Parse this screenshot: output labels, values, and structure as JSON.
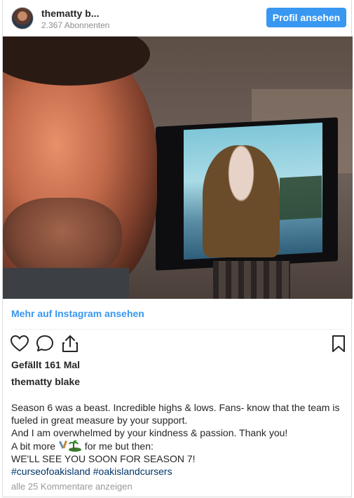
{
  "header": {
    "username": "thematty b...",
    "followers": "2.367 Abonnenten",
    "profile_button": "Profil ansehen"
  },
  "photo": {
    "alt_icon": "photo"
  },
  "more_link": "Mehr auf Instagram ansehen",
  "actions": {
    "like_icon": "heart-icon",
    "comment_icon": "comment-icon",
    "share_icon": "share-icon",
    "save_icon": "bookmark-icon"
  },
  "likes": "Gefällt 161 Mal",
  "caption": {
    "username": "thematty blake",
    "line1": "Season 6 was a beast. Incredible highs & lows. Fans- know that the team is",
    "line2": "fueled in great measure by your support.",
    "line3": "And I am overwhelmed by your kindness & passion. Thank you!",
    "line4_before": "A bit more ",
    "line4_after": " for me but then:",
    "line5": "WE'LL SEE YOU SOON FOR SEASON 7!",
    "hashtag1": "#curseofoakisland",
    "hashtag2": "#oakislandcursers"
  },
  "comments_link": "alle 25 Kommentare anzeigen",
  "colors": {
    "accent": "#3897f0",
    "hashtag": "#003569",
    "muted": "#8e8e8e"
  }
}
